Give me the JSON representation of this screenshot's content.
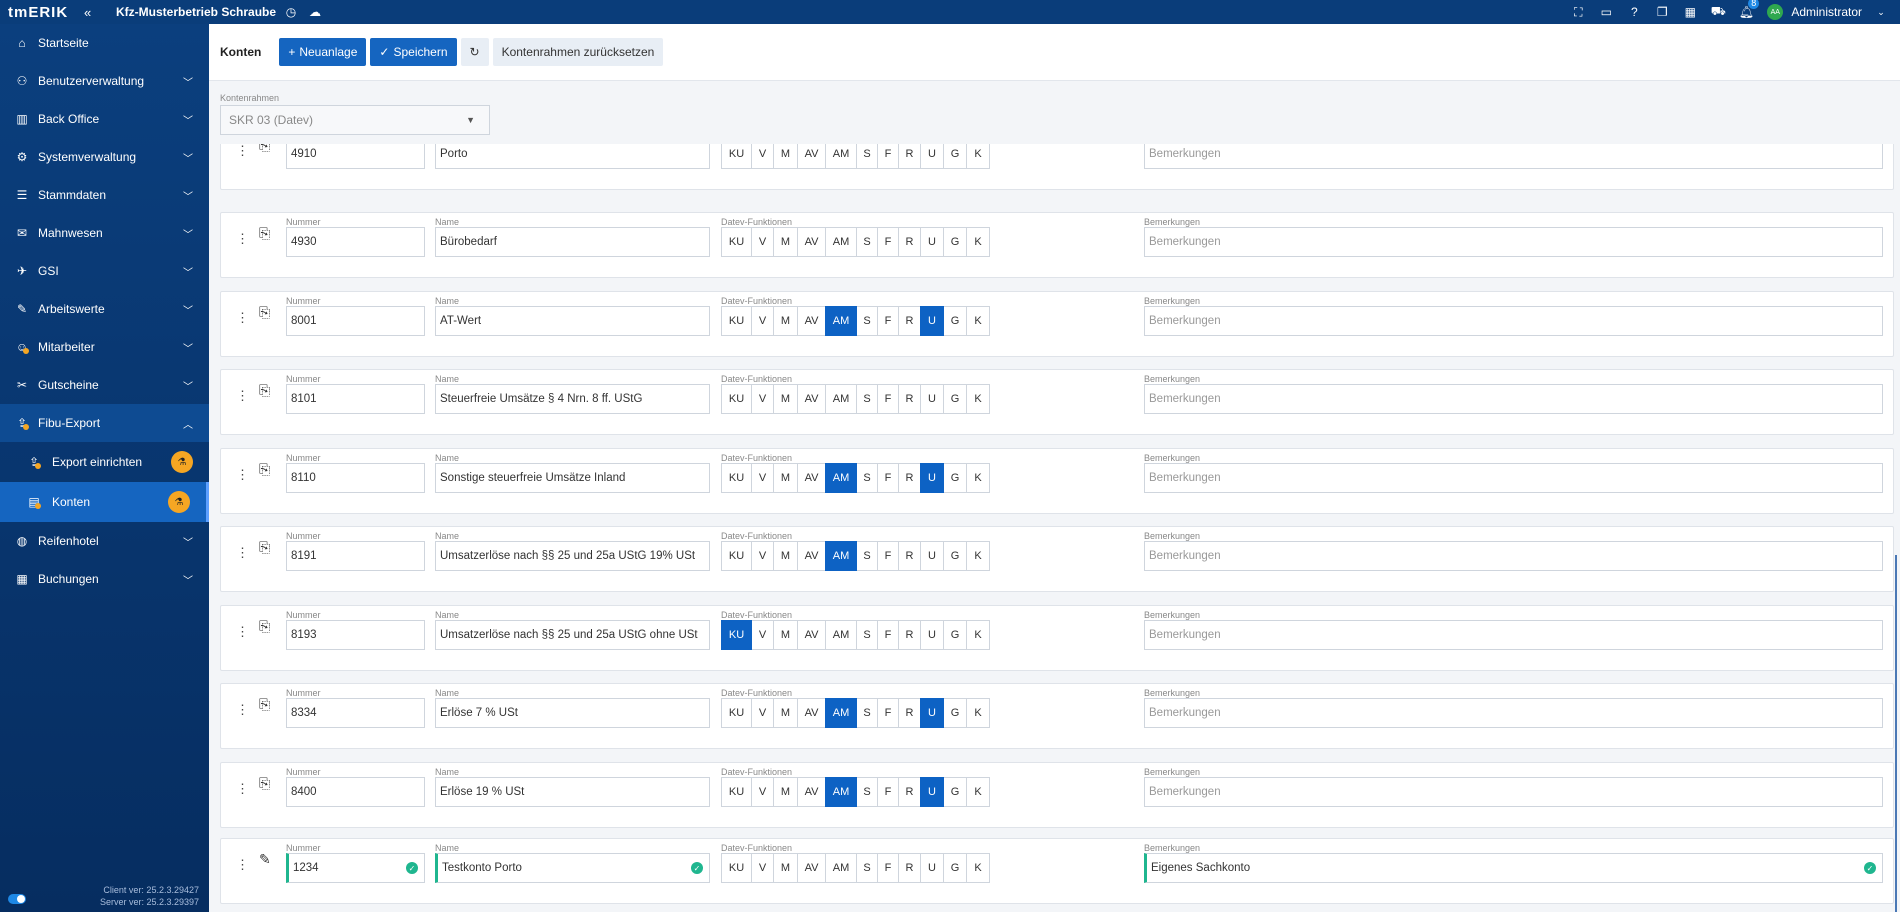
{
  "app": {
    "logo": "tmERIK",
    "company": "Kfz-Musterbetrieb Schraube",
    "notification_count": "8",
    "avatar_initials": "AA",
    "user": "Administrator"
  },
  "sidebar": {
    "items": [
      {
        "label": "Startseite",
        "icon": "home-icon",
        "chev": false
      },
      {
        "label": "Benutzerverwaltung",
        "icon": "users-icon",
        "chev": true
      },
      {
        "label": "Back Office",
        "icon": "office-icon",
        "chev": true
      },
      {
        "label": "Systemverwaltung",
        "icon": "system-icon",
        "chev": true
      },
      {
        "label": "Stammdaten",
        "icon": "master-data-icon",
        "chev": true
      },
      {
        "label": "Mahnwesen",
        "icon": "dunning-icon",
        "chev": true
      },
      {
        "label": "GSI",
        "icon": "gsi-icon",
        "chev": true
      },
      {
        "label": "Arbeitswerte",
        "icon": "work-values-icon",
        "chev": true
      },
      {
        "label": "Mitarbeiter",
        "icon": "employee-icon",
        "chev": true
      },
      {
        "label": "Gutscheine",
        "icon": "voucher-icon",
        "chev": true
      },
      {
        "label": "Fibu-Export",
        "icon": "export-icon",
        "chev": true,
        "open": true
      }
    ],
    "sub_items": [
      {
        "label": "Export einrichten",
        "icon": "export-setup-icon"
      },
      {
        "label": "Konten",
        "icon": "accounts-icon",
        "active": true
      }
    ],
    "after_items": [
      {
        "label": "Reifenhotel",
        "icon": "tire-icon"
      },
      {
        "label": "Buchungen",
        "icon": "booking-icon"
      }
    ],
    "client_version": "Client ver: 25.2.3.29427",
    "server_version": "Server ver: 25.2.3.29397"
  },
  "toolbar": {
    "title": "Konten",
    "new_label": "Neuanlage",
    "save_label": "Speichern",
    "reset_label": "Kontenrahmen zurücksetzen"
  },
  "kontenrahmen": {
    "label": "Kontenrahmen",
    "value": "SKR 03 (Datev)"
  },
  "field_labels": {
    "nummer": "Nummer",
    "name": "Name",
    "datev": "Datev-Funktionen",
    "bemerkungen": "Bemerkungen",
    "bemerkungen_placeholder": "Bemerkungen"
  },
  "flag_keys": [
    "KU",
    "V",
    "M",
    "AV",
    "AM",
    "S",
    "F",
    "R",
    "U",
    "G",
    "K"
  ],
  "accounts": [
    {
      "nummer": "4910",
      "name": "Porto",
      "active": [],
      "bemerkung": ""
    },
    {
      "nummer": "4930",
      "name": "Bürobedarf",
      "active": [],
      "bemerkung": ""
    },
    {
      "nummer": "8001",
      "name": "AT-Wert",
      "active": [
        "AM",
        "U"
      ],
      "bemerkung": ""
    },
    {
      "nummer": "8101",
      "name": "Steuerfreie Umsätze § 4 Nrn. 8 ff. UStG",
      "active": [],
      "bemerkung": ""
    },
    {
      "nummer": "8110",
      "name": "Sonstige steuerfreie Umsätze Inland",
      "active": [
        "AM",
        "U"
      ],
      "bemerkung": ""
    },
    {
      "nummer": "8191",
      "name": "Umsatzerlöse nach §§ 25 und 25a UStG 19% USt",
      "active": [
        "AM"
      ],
      "bemerkung": ""
    },
    {
      "nummer": "8193",
      "name": "Umsatzerlöse nach §§ 25 und 25a UStG ohne USt",
      "active": [
        "KU"
      ],
      "bemerkung": ""
    },
    {
      "nummer": "8334",
      "name": "Erlöse 7 % USt",
      "active": [
        "AM",
        "U"
      ],
      "bemerkung": ""
    },
    {
      "nummer": "8400",
      "name": "Erlöse 19 % USt",
      "active": [
        "AM",
        "U"
      ],
      "bemerkung": ""
    },
    {
      "nummer": "1234",
      "name": "Testkonto Porto",
      "active": [],
      "bemerkung": "Eigenes Sachkonto",
      "editing": true
    }
  ]
}
